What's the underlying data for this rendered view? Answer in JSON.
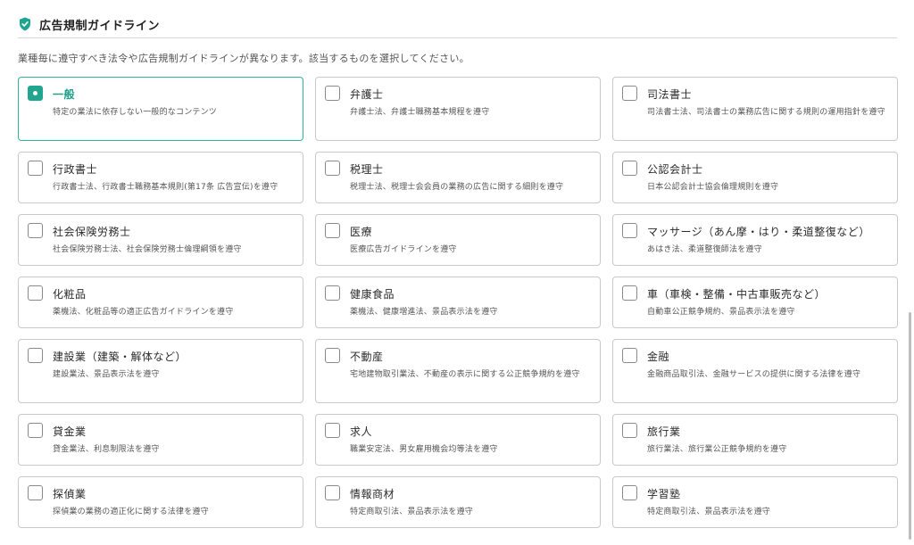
{
  "section": {
    "title": "広告規制ガイドライン",
    "description": "業種毎に遵守すべき法令や広告規制ガイドラインが異なります。該当するものを選択してください。"
  },
  "colors": {
    "accent": "#22a58e",
    "border": "#c9c9c9"
  },
  "industries": [
    {
      "name": "一般",
      "laws": "特定の業法に依存しない一般的なコンテンツ",
      "checked": true
    },
    {
      "name": "弁護士",
      "laws": "弁護士法、弁護士職務基本規程を遵守",
      "checked": false
    },
    {
      "name": "司法書士",
      "laws": "司法書士法、司法書士の業務広告に関する規則の運用指針を遵守",
      "checked": false
    },
    {
      "name": "行政書士",
      "laws": "行政書士法、行政書士職務基本規則(第17条 広告宣伝)を遵守",
      "checked": false
    },
    {
      "name": "税理士",
      "laws": "税理士法、税理士会会員の業務の広告に関する細則を遵守",
      "checked": false
    },
    {
      "name": "公認会計士",
      "laws": "日本公認会計士協会倫理規則を遵守",
      "checked": false
    },
    {
      "name": "社会保険労務士",
      "laws": "社会保険労務士法、社会保険労務士倫理綱領を遵守",
      "checked": false
    },
    {
      "name": "医療",
      "laws": "医療広告ガイドラインを遵守",
      "checked": false
    },
    {
      "name": "マッサージ（あん摩・はり・柔道整復など）",
      "laws": "あはき法、柔道整復師法を遵守",
      "checked": false
    },
    {
      "name": "化粧品",
      "laws": "薬機法、化粧品等の適正広告ガイドラインを遵守",
      "checked": false
    },
    {
      "name": "健康食品",
      "laws": "薬機法、健康増進法、景品表示法を遵守",
      "checked": false
    },
    {
      "name": "車（車検・整備・中古車販売など）",
      "laws": "自動車公正競争規約、景品表示法を遵守",
      "checked": false
    },
    {
      "name": "建設業（建築・解体など）",
      "laws": "建設業法、景品表示法を遵守",
      "checked": false
    },
    {
      "name": "不動産",
      "laws": "宅地建物取引業法、不動産の表示に関する公正競争規約を遵守",
      "checked": false
    },
    {
      "name": "金融",
      "laws": "金融商品取引法、金融サービスの提供に関する法律を遵守",
      "checked": false
    },
    {
      "name": "貸金業",
      "laws": "貸金業法、利息制限法を遵守",
      "checked": false
    },
    {
      "name": "求人",
      "laws": "職業安定法、男女雇用機会均等法を遵守",
      "checked": false
    },
    {
      "name": "旅行業",
      "laws": "旅行業法、旅行業公正競争規約を遵守",
      "checked": false
    },
    {
      "name": "探偵業",
      "laws": "探偵業の業務の適正化に関する法律を遵守",
      "checked": false
    },
    {
      "name": "情報商材",
      "laws": "特定商取引法、景品表示法を遵守",
      "checked": false
    },
    {
      "name": "学習塾",
      "laws": "特定商取引法、景品表示法を遵守",
      "checked": false
    }
  ]
}
